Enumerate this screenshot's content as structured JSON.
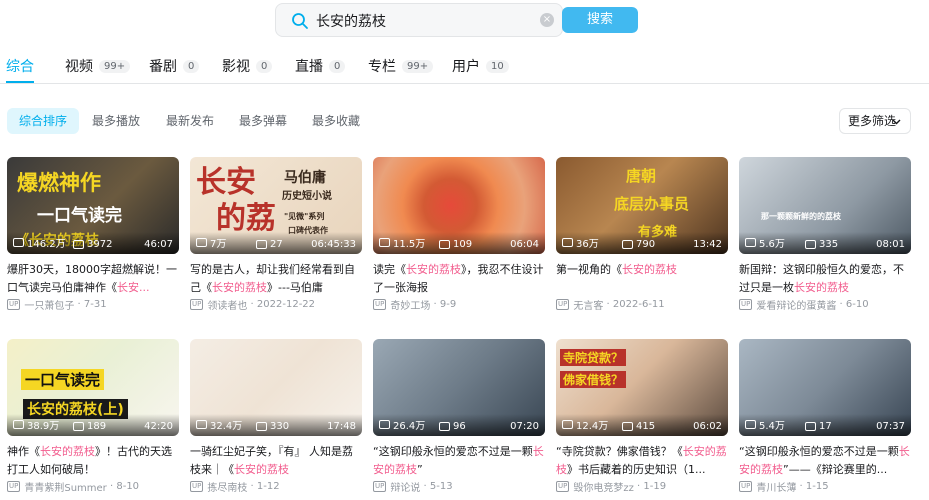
{
  "search": {
    "query": "长安的荔枝",
    "button": "搜索"
  },
  "tabs": [
    {
      "label": "综合",
      "count": ""
    },
    {
      "label": "视频",
      "count": "99+"
    },
    {
      "label": "番剧",
      "count": "0"
    },
    {
      "label": "影视",
      "count": "0"
    },
    {
      "label": "直播",
      "count": "0"
    },
    {
      "label": "专栏",
      "count": "99+"
    },
    {
      "label": "用户",
      "count": "10"
    }
  ],
  "filters": [
    "综合排序",
    "最多播放",
    "最新发布",
    "最多弹幕",
    "最多收藏"
  ],
  "more_filters": "更多筛选",
  "videos": [
    {
      "plays": "146.2万",
      "danmaku": "3972",
      "duration": "46:07",
      "title_a": "爆肝30天，18000字超燃解说！一口气读完马伯庸神作《",
      "title_hl": "长安...",
      "title_b": "",
      "author": "一只萧包子",
      "date": "7-31",
      "thumb_lines": [
        "爆燃神作",
        "一口气读完",
        "《长安的荔枝"
      ]
    },
    {
      "plays": "7万",
      "danmaku": "27",
      "duration": "06:45:33",
      "title_a": "写的是古人，却让我们经常看到自己《",
      "title_hl": "长安的荔枝",
      "title_b": "》---马伯庸",
      "author": "领读者也",
      "date": "2022-12-22",
      "thumb_lines": [
        "长安",
        "的荔",
        "马伯庸",
        "历史短小说",
        "\"见微\"系列",
        "口碑代表作"
      ]
    },
    {
      "plays": "11.5万",
      "danmaku": "109",
      "duration": "06:04",
      "title_a": "读完《",
      "title_hl": "长安的荔枝",
      "title_b": "》，我忍不住设计了一张海报",
      "author": "奇妙工场",
      "date": "9-9",
      "thumb_lines": []
    },
    {
      "plays": "36万",
      "danmaku": "790",
      "duration": "13:42",
      "title_a": "第一视角的《",
      "title_hl": "长安的荔枝",
      "title_b": "",
      "author": "无言客",
      "date": "2022-6-11",
      "thumb_lines": [
        "唐朝",
        "底层办事员",
        "有多难"
      ]
    },
    {
      "plays": "5.6万",
      "danmaku": "335",
      "duration": "08:01",
      "title_a": "新国辩：这钢印般恒久的爱恋，不过只是一枚",
      "title_hl": "长安的荔枝",
      "title_b": "",
      "author": "爱看辩论的蛋黄酱",
      "date": "6-10",
      "thumb_lines": [
        "那一颗颗新鲜的的荔枝"
      ]
    },
    {
      "plays": "38.9万",
      "danmaku": "189",
      "duration": "42:20",
      "title_a": "神作《",
      "title_hl": "长安的荔枝",
      "title_b": "》！古代的天选打工人如何破局！",
      "author": "青青紫荆Summer",
      "date": "8-10",
      "thumb_lines": [
        "一口气读完",
        "长安的荔枝(上)"
      ]
    },
    {
      "plays": "32.4万",
      "danmaku": "330",
      "duration": "17:48",
      "title_a": "一骑红尘妃子笑，『有』 人知是荔枝来｜《",
      "title_hl": "长安的荔枝",
      "title_b": "",
      "author": "拣尽南枝",
      "date": "1-12",
      "thumb_lines": []
    },
    {
      "plays": "26.4万",
      "danmaku": "96",
      "duration": "07:20",
      "title_a": "“这钢印般永恒的爱恋不过是一颗",
      "title_hl": "长安的荔枝",
      "title_b": "”",
      "author": "辩论说",
      "date": "5-13",
      "thumb_lines": []
    },
    {
      "plays": "12.4万",
      "danmaku": "415",
      "duration": "06:02",
      "title_a": "“寺院贷款？佛家借钱？《",
      "title_hl": "长安的荔枝",
      "title_b": "》书后藏着的历史知识（1...",
      "author": "毁你电竞梦zz",
      "date": "1-19",
      "thumb_lines": [
        "寺院贷款？",
        "佛家借钱？"
      ]
    },
    {
      "plays": "5.4万",
      "danmaku": "17",
      "duration": "07:37",
      "title_a": "“这钢印般永恒的爱恋不过是一颗",
      "title_hl": "长安的荔枝",
      "title_b": "”——《辩论赛里的...",
      "author": "青川长薄",
      "date": "1-15",
      "thumb_lines": []
    }
  ],
  "colors": {
    "accent": "#00aeec",
    "highlight": "#f25d8e",
    "button": "#41b9f0"
  }
}
